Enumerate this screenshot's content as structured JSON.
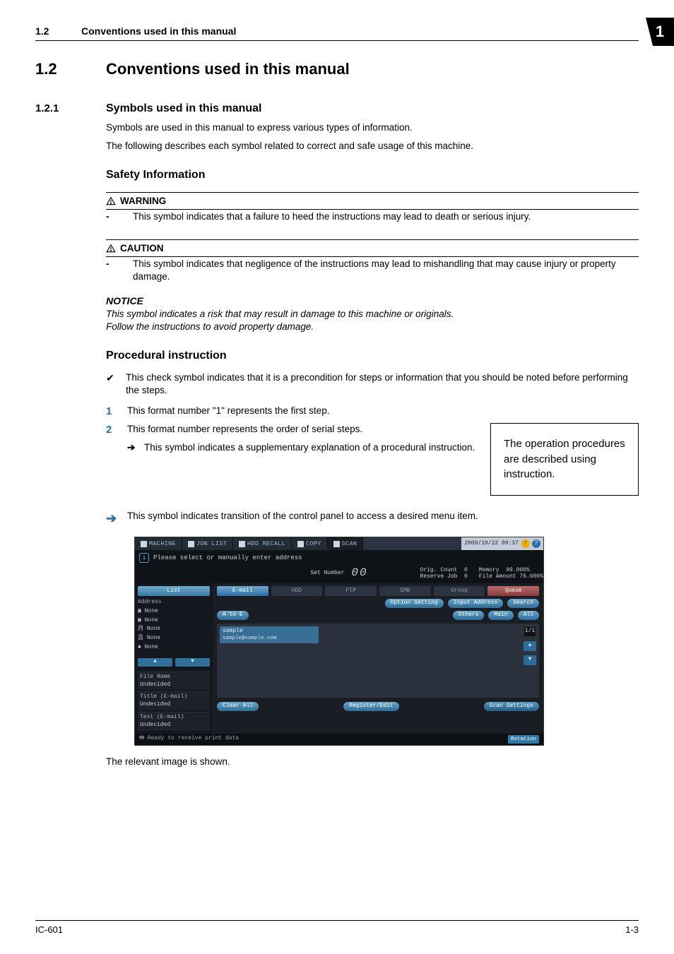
{
  "header": {
    "num": "1.2",
    "title": "Conventions used in this manual",
    "chapter": "1"
  },
  "section": {
    "num": "1.2",
    "title": "Conventions used in this manual"
  },
  "subsection": {
    "num": "1.2.1",
    "title": "Symbols used in this manual"
  },
  "intro1": "Symbols are used in this manual to express various types of information.",
  "intro2": "The following describes each symbol related to correct and safe usage of this machine.",
  "safety_heading": "Safety Information",
  "warning": {
    "label": "WARNING",
    "item": "This symbol indicates that a failure to heed the instructions may lead to death or serious injury."
  },
  "caution": {
    "label": "CAUTION",
    "item": "This symbol indicates that negligence of the instructions may lead to mishandling that may cause injury or property damage."
  },
  "notice": {
    "label": "NOTICE",
    "line1": "This symbol indicates a risk that may result in damage to this machine or originals.",
    "line2": "Follow the instructions to avoid property damage."
  },
  "proc_heading": "Procedural instruction",
  "check_item": "This check symbol indicates that it is a precondition for steps or information that you should be noted before performing the steps.",
  "step1": {
    "num": "1",
    "text": "This format number \"1\" represents the first step."
  },
  "step2": {
    "num": "2",
    "text": "This format number represents the order of serial steps.",
    "arrow": "This symbol indicates a supplementary explanation of a procedural instruction."
  },
  "aside": "The operation procedures are described using instruction.",
  "transition_arrow": "This symbol indicates transition of the control panel to access a desired menu item.",
  "relevant_image": "The relevant image is shown.",
  "footer": {
    "left": "IC-601",
    "right": "1-3"
  },
  "panel": {
    "tabs": {
      "machine": "MACHINE",
      "joblist": "JOB LIST",
      "recall": "HDD RECALL",
      "copy": "COPY",
      "scan": "SCAN"
    },
    "datetime": "2009/10/22 09:37",
    "prompt": "Please select or manually enter address",
    "set_number_label": "Set Number",
    "set_number_value": "00",
    "status": {
      "orig_label": "Orig. Count",
      "orig_val": "0",
      "reserve_label": "Reserve Job",
      "reserve_val": "0",
      "memory_label": "Memory",
      "memory_val": "99.000%",
      "file_label": "File Amount",
      "file_val": "76.600%"
    },
    "side": {
      "list": "List",
      "address": "Address",
      "l1": "None",
      "l2": "None",
      "l3": "None",
      "l4": "None",
      "l5": "None",
      "nav_up": "▲",
      "nav_down": "▼",
      "file_name": "File Name",
      "file_name_v": "Undecided",
      "title": "Title (E-mail)",
      "title_v": "Undecided",
      "text": "Text (E-mail)",
      "text_v": "Undecided"
    },
    "cat": {
      "email": "E-mail",
      "hdd": "HDD",
      "ftp": "FTP",
      "smb": "SMB",
      "group": "Group",
      "queue": "Queue"
    },
    "act": {
      "option": "Option Setting",
      "input": "Input Address",
      "search": "Search"
    },
    "filt": {
      "atoz": "A to E",
      "others": "Others",
      "main": "Main",
      "all": "All"
    },
    "addr": {
      "name": "sample",
      "sub": "sample@sample.com"
    },
    "page": {
      "cur": "1",
      "tot": "1"
    },
    "bottom": {
      "clear": "Clear All",
      "register": "Register/Edit",
      "scan": "Scan Settings"
    },
    "statusbar": "Ready to receive print data",
    "rotation": "Rotation"
  }
}
